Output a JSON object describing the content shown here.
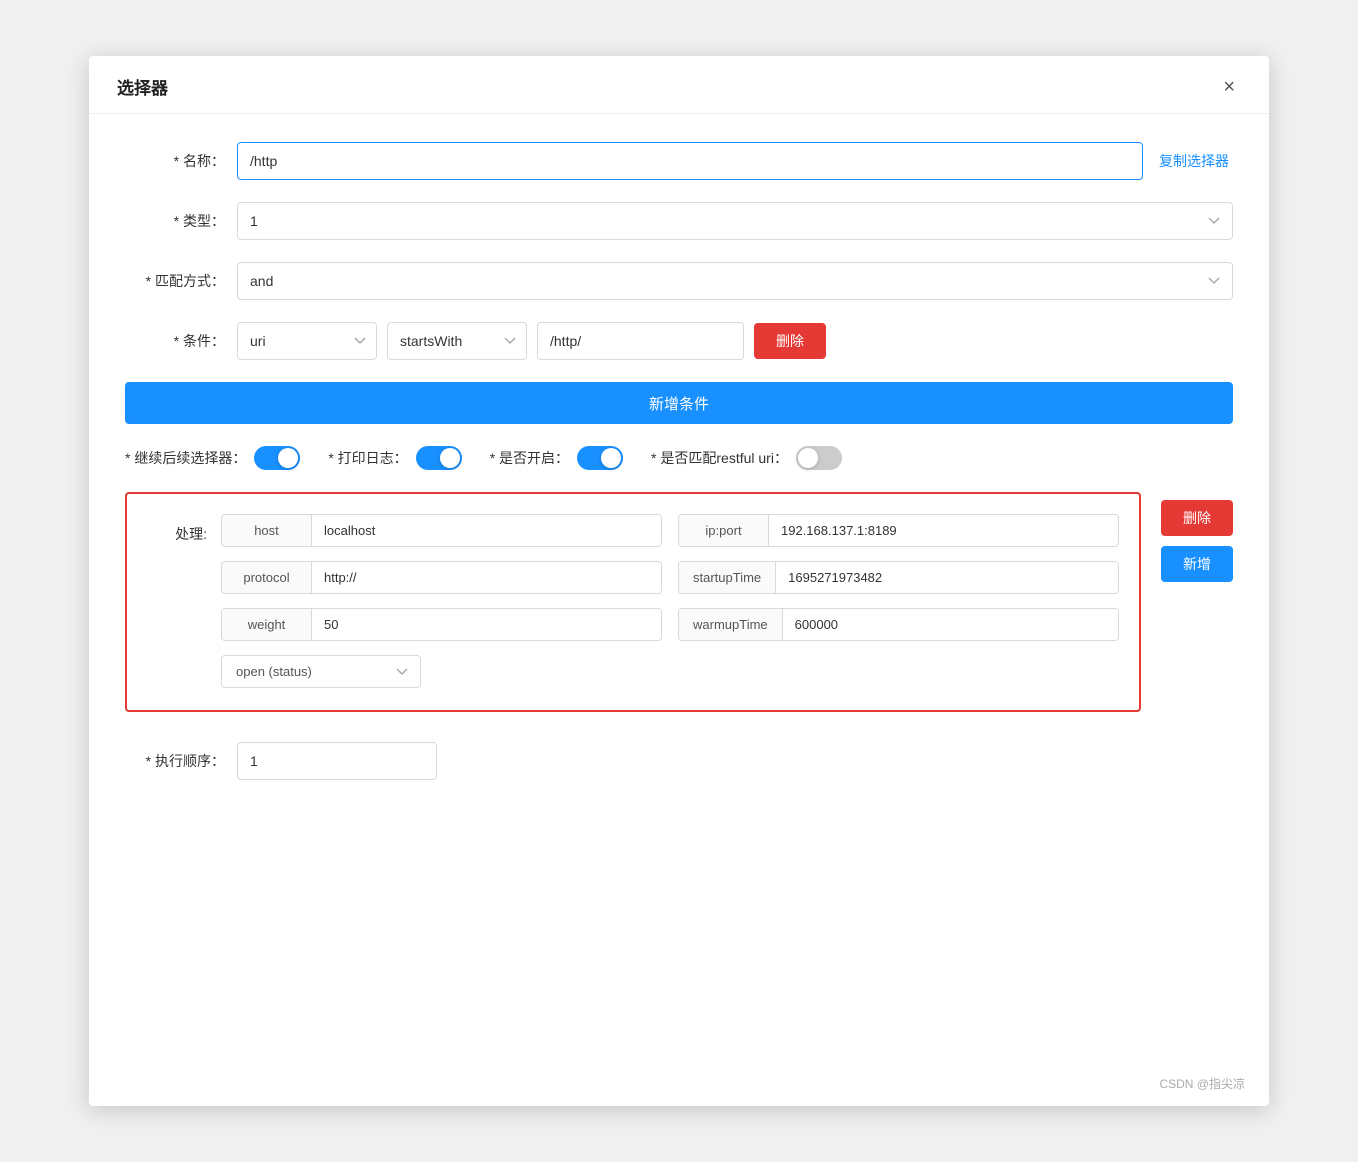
{
  "dialog": {
    "title": "选择器",
    "close_label": "×"
  },
  "form": {
    "name_label": "* 名称：",
    "name_value": "/http",
    "copy_btn_label": "复制选择器",
    "type_label": "* 类型：",
    "type_value": "1",
    "match_label": "* 匹配方式：",
    "match_value": "and",
    "condition_label": "* 条件：",
    "cond_uri": "uri",
    "cond_method": "startsWith",
    "cond_value": "/http/",
    "delete_btn_label": "删除",
    "add_condition_btn": "新增条件",
    "continue_label": "* 继续后续选择器：",
    "print_log_label": "* 打印日志：",
    "enable_label": "* 是否开启：",
    "restful_label": "* 是否匹配restful uri：",
    "continue_on": true,
    "print_log_on": true,
    "enable_on": true,
    "restful_on": false,
    "handler_label": "处理:",
    "handler_fields": {
      "host_key": "host",
      "host_value": "localhost",
      "ip_port_key": "ip:port",
      "ip_port_value": "192.168.137.1:8189",
      "protocol_key": "protocol",
      "protocol_value": "http://",
      "startup_time_key": "startupTime",
      "startup_time_value": "1695271973482",
      "weight_key": "weight",
      "weight_value": "50",
      "warmup_time_key": "warmupTime",
      "warmup_time_value": "600000",
      "status_value": "open (status)"
    },
    "handler_delete_btn": "删除",
    "handler_new_btn": "新增",
    "exec_order_label": "* 执行顺序：",
    "exec_order_value": "1"
  },
  "footer": {
    "note": "CSDN @指尖凉"
  }
}
